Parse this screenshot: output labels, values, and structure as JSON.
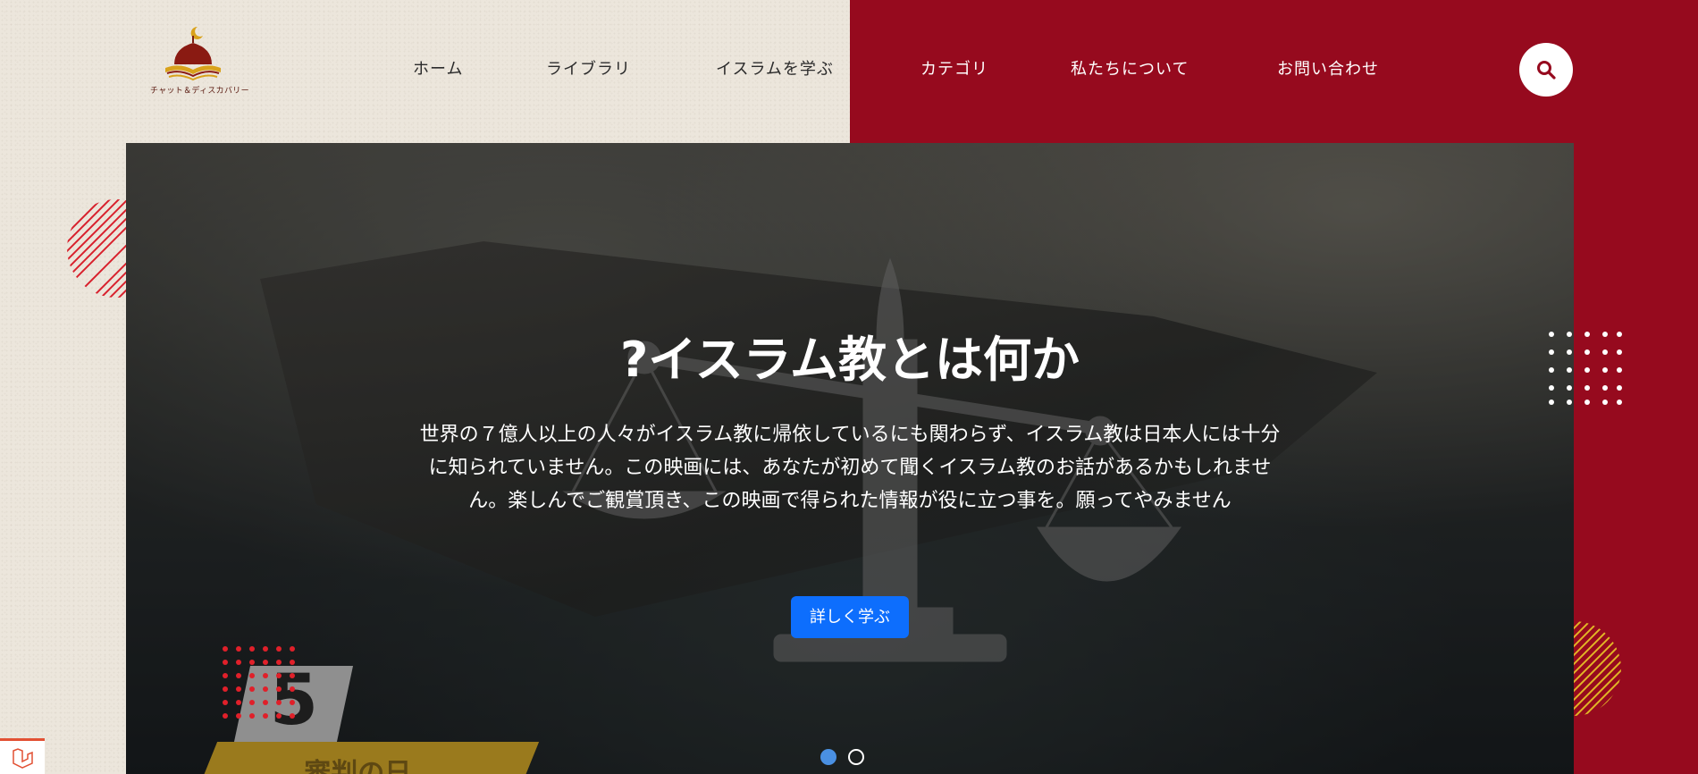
{
  "logo": {
    "text": "チャット＆ディスカバリー",
    "icon": "mosque-book-logo-icon"
  },
  "nav": {
    "items": [
      {
        "label": "ホーム"
      },
      {
        "label": "ライブラリ"
      },
      {
        "label": "イスラムを学ぶ"
      },
      {
        "label": "カテゴリ"
      },
      {
        "label": "私たちについて"
      },
      {
        "label": "お問い合わせ"
      }
    ],
    "search_icon": "search-icon"
  },
  "hero": {
    "title": "?イスラム教とは何か",
    "description": "世界の７億人以上の人々がイスラム教に帰依しているにも関わらず、イスラム教は日本人には十分に知られていません。この映画には、あなたが初めて聞くイスラム教のお話があるかもしれません。楽しんでご観賞頂き、この映画で得られた情報が役に立つ事を。願ってやみません",
    "button_label": "詳しく学ぶ",
    "badge_number": "5",
    "badge_text": "審判の日"
  },
  "carousel": {
    "slides": 2,
    "active_index": 0
  },
  "colors": {
    "accent_red": "#960a1e",
    "primary_button": "#0d6efd",
    "page_bg": "#ece6dc",
    "dot_active": "#4a90e2"
  }
}
